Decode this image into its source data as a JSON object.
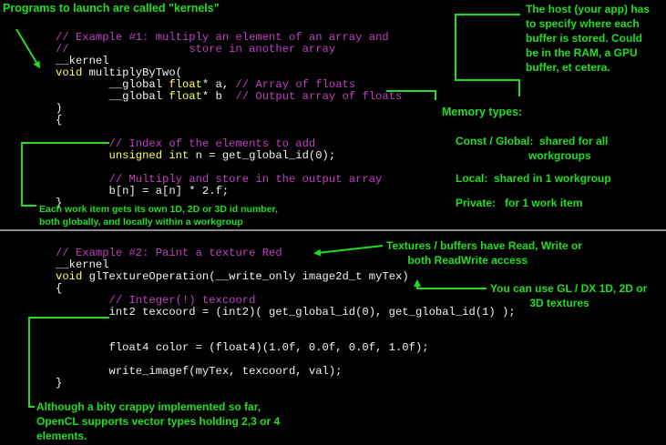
{
  "colors": {
    "background": "#000000",
    "code_text": "#f2f2f2",
    "comment": "#c040c0",
    "keyword": "#ffff55",
    "annotation": "#22dd22",
    "divider": "#8a8a8a"
  },
  "annotations": {
    "kernels_title": "Programs to launch are called \"kernels\"",
    "host_note": "The host (your app) has\nto specify where each\nbuffer is stored. Could\nbe in the RAM, a GPU\nbuffer, et cetera.",
    "memory_types": {
      "title": "Memory types:",
      "const_global": "Const / Global:  shared for all\n                        workgroups",
      "local": "Local:  shared in 1 workgroup",
      "private": "Private:   for 1 work item"
    },
    "work_item_note": "Each work item gets its own 1D, 2D or 3D id number,\nboth globally, and locally within a workgroup",
    "textures_note": "Textures / buffers have Read, Write or\n       both ReadWrite access",
    "gl_dx_note": "You can use GL / DX 1D, 2D or\n             3D textures",
    "vector_note": "Although a bity crappy implemented so far,\nOpenCL supports vector types holding 2,3 or 4\nelements."
  },
  "example1": {
    "c1": "// Example #1: multiply an element of an array and",
    "c2": "//                  store in another array",
    "kernel": "__kernel",
    "sig_kw": "void",
    "sig_rest": " multiplyByTwo(",
    "p1_a": "        __global ",
    "p1_kw": "float",
    "p1_b": "* a, ",
    "p1_c": "// Array of floats",
    "p2_a": "        __global ",
    "p2_kw": "float",
    "p2_b": "* b  ",
    "p2_c": "// Output array of floats",
    "close_paren": ")",
    "open_brace": "{",
    "c3": "        // Index of the elements to add",
    "l1_kw": "        unsigned int",
    "l1_rest": " n = get_global_id(0);",
    "c4": "        // Multiply and store in the output array",
    "l2": "        b[n] = a[n] * 2.f;",
    "close_brace": "}"
  },
  "example2": {
    "c1": "// Example #2: Paint a texture Red",
    "kernel": "__kernel",
    "sig_kw": "void",
    "sig_rest": " glTextureOperation(__write_only image2d_t myTex)",
    "open_brace": "{",
    "c2": "        // Integer(!) texcoord",
    "l1": "        int2 texcoord = (int2)( get_global_id(0), get_global_id(1) );",
    "l2": "        float4 color = (float4)(1.0f, 0.0f, 0.0f, 1.0f);",
    "l3": "        write_imagef(myTex, texcoord, val);",
    "close_brace": "}"
  }
}
